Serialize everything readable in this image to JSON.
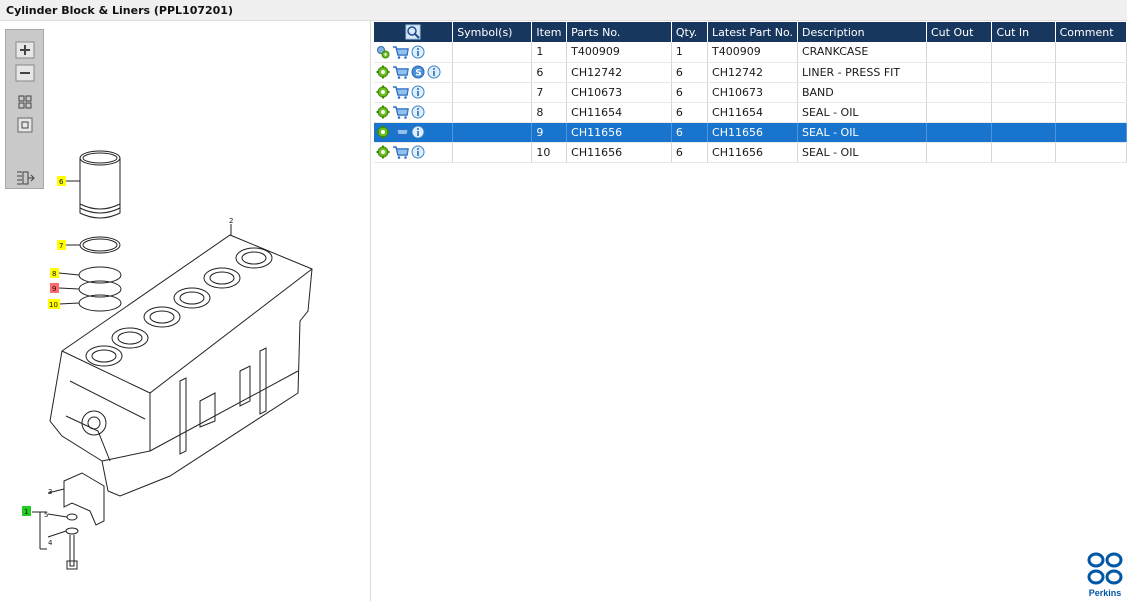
{
  "window": {
    "title": "Cylinder Block & Liners (PPL107201)"
  },
  "colors": {
    "header_bg": "#17375e",
    "selected_row": "#1874cd",
    "brand_blue": "#0057a6"
  },
  "toolbar": {
    "buttons": [
      "zoom-in-icon",
      "zoom-out-icon",
      "fit-view-icon",
      "actual-size-icon",
      "export-list-icon"
    ]
  },
  "diagram": {
    "callouts": [
      {
        "label": "6",
        "color": "yellow"
      },
      {
        "label": "7",
        "color": "yellow"
      },
      {
        "label": "8",
        "color": "yellow"
      },
      {
        "label": "9",
        "color": "red"
      },
      {
        "label": "10",
        "color": "yellow"
      },
      {
        "label": "1",
        "color": "green"
      }
    ],
    "plain_labels": [
      "2",
      "3",
      "5",
      "4"
    ]
  },
  "table": {
    "columns": [
      "",
      "Symbol(s)",
      "Item",
      "Parts No.",
      "Qty.",
      "Latest Part No.",
      "Description",
      "Cut Out",
      "Cut In",
      "Comment"
    ],
    "rows": [
      {
        "icons": [
          "gears-icon",
          "cart-icon",
          "info-icon"
        ],
        "symbol": "",
        "item": "1",
        "part_no": "T400909",
        "qty": "1",
        "latest": "T400909",
        "description": "CRANKCASE",
        "cut_out": "",
        "cut_in": "",
        "comment": "",
        "selected": false
      },
      {
        "icons": [
          "gear-icon",
          "cart-icon",
          "s-icon",
          "info-icon"
        ],
        "symbol": "",
        "item": "6",
        "part_no": "CH12742",
        "qty": "6",
        "latest": "CH12742",
        "description": "LINER - PRESS FIT",
        "cut_out": "",
        "cut_in": "",
        "comment": "",
        "selected": false
      },
      {
        "icons": [
          "gear-icon",
          "cart-icon",
          "info-icon"
        ],
        "symbol": "",
        "item": "7",
        "part_no": "CH10673",
        "qty": "6",
        "latest": "CH10673",
        "description": "BAND",
        "cut_out": "",
        "cut_in": "",
        "comment": "",
        "selected": false
      },
      {
        "icons": [
          "gear-icon",
          "cart-icon",
          "info-icon"
        ],
        "symbol": "",
        "item": "8",
        "part_no": "CH11654",
        "qty": "6",
        "latest": "CH11654",
        "description": "SEAL - OIL",
        "cut_out": "",
        "cut_in": "",
        "comment": "",
        "selected": false
      },
      {
        "icons": [
          "gear-icon",
          "cart-icon",
          "info-icon"
        ],
        "symbol": "",
        "item": "9",
        "part_no": "CH11656",
        "qty": "6",
        "latest": "CH11656",
        "description": "SEAL - OIL",
        "cut_out": "",
        "cut_in": "",
        "comment": "",
        "selected": true
      },
      {
        "icons": [
          "gear-icon",
          "cart-icon",
          "info-icon"
        ],
        "symbol": "",
        "item": "10",
        "part_no": "CH11656",
        "qty": "6",
        "latest": "CH11656",
        "description": "SEAL - OIL",
        "cut_out": "",
        "cut_in": "",
        "comment": "",
        "selected": false
      }
    ]
  },
  "brand": {
    "name": "Perkins"
  }
}
